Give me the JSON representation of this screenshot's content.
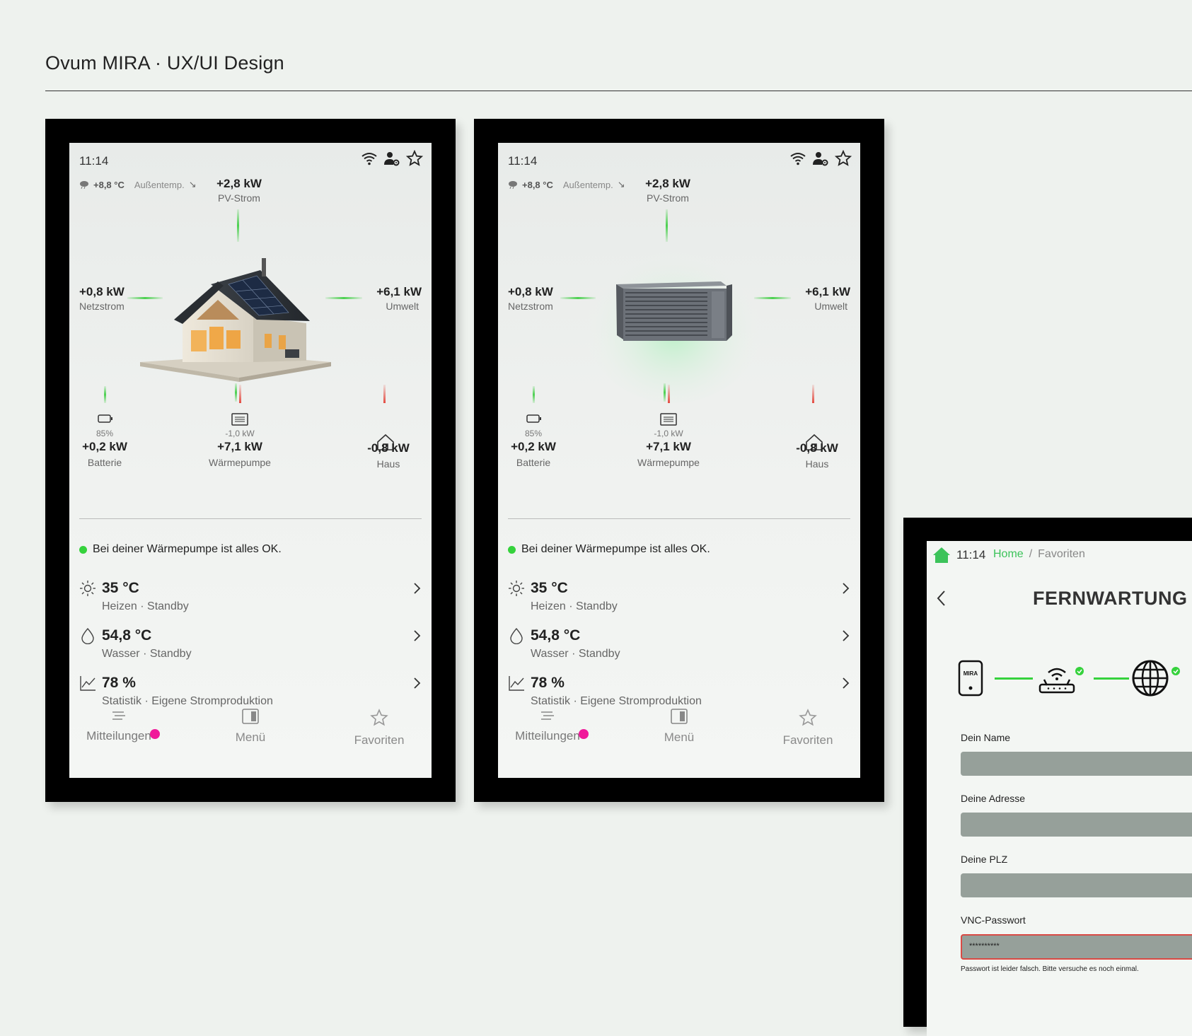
{
  "page_title": "Ovum MIRA · UX/UI Design",
  "dashboards": [
    {
      "clock": "11:14",
      "weather_temp": "+8,8 °C",
      "weather_label": "Außentemp.",
      "trend_arrow": "↘",
      "pv": {
        "value": "+2,8 kW",
        "label": "PV-Strom"
      },
      "grid": {
        "value": "+0,8 kW",
        "label": "Netzstrom"
      },
      "env": {
        "value": "+6,1 kW",
        "label": "Umwelt"
      },
      "battery": {
        "percent": "85%",
        "value": "+0,2 kW",
        "label": "Batterie"
      },
      "heatpump": {
        "sub": "-1,0 kW",
        "value": "+7,1 kW",
        "label": "Wärmepumpe"
      },
      "house": {
        "value": "-0,8 kW",
        "label": "Haus"
      },
      "status_message": "Bei deiner Wärmepumpe ist alles OK.",
      "rows": [
        {
          "value": "35 °C",
          "desc": "Heizen · Standby",
          "icon": "sun-icon"
        },
        {
          "value": "54,8 °C",
          "desc": "Wasser · Standby",
          "icon": "drop-icon"
        },
        {
          "value": "78 %",
          "desc": "Statistik · Eigene Stromproduktion",
          "icon": "chart-icon"
        }
      ],
      "nav": {
        "messages": "Mitteilungen",
        "menu": "Menü",
        "favorites": "Favoriten"
      }
    },
    {
      "clock": "11:14",
      "weather_temp": "+8,8 °C",
      "weather_label": "Außentemp.",
      "trend_arrow": "↘",
      "pv": {
        "value": "+2,8 kW",
        "label": "PV-Strom"
      },
      "grid": {
        "value": "+0,8 kW",
        "label": "Netzstrom"
      },
      "env": {
        "value": "+6,1 kW",
        "label": "Umwelt"
      },
      "battery": {
        "percent": "85%",
        "value": "+0,2 kW",
        "label": "Batterie"
      },
      "heatpump": {
        "sub": "-1,0 kW",
        "value": "+7,1 kW",
        "label": "Wärmepumpe"
      },
      "house": {
        "value": "-0,8 kW",
        "label": "Haus"
      },
      "status_message": "Bei deiner Wärmepumpe ist alles OK.",
      "rows": [
        {
          "value": "35 °C",
          "desc": "Heizen · Standby",
          "icon": "sun-icon"
        },
        {
          "value": "54,8 °C",
          "desc": "Wasser · Standby",
          "icon": "drop-icon"
        },
        {
          "value": "78 %",
          "desc": "Statistik · Eigene Stromproduktion",
          "icon": "chart-icon"
        }
      ],
      "nav": {
        "messages": "Mitteilungen",
        "menu": "Menü",
        "favorites": "Favoriten"
      }
    }
  ],
  "remote": {
    "clock": "11:14",
    "breadcrumb_home": "Home",
    "breadcrumb_sep": "/",
    "breadcrumb_current": "Favoriten",
    "title": "FERNWARTUNG",
    "device_label": "MIRA",
    "fields": [
      {
        "label": "Dein Name",
        "value": ""
      },
      {
        "label": "Deine Adresse",
        "value": ""
      },
      {
        "label": "Deine PLZ",
        "value": ""
      },
      {
        "label": "VNC-Passwort",
        "value": "**********"
      }
    ],
    "error_message": "Passwort ist leider falsch. Bitte versuche es noch einmal.",
    "colors": {
      "accent": "#35d23c",
      "error": "#d94a44",
      "link": "#3cc35a"
    }
  }
}
